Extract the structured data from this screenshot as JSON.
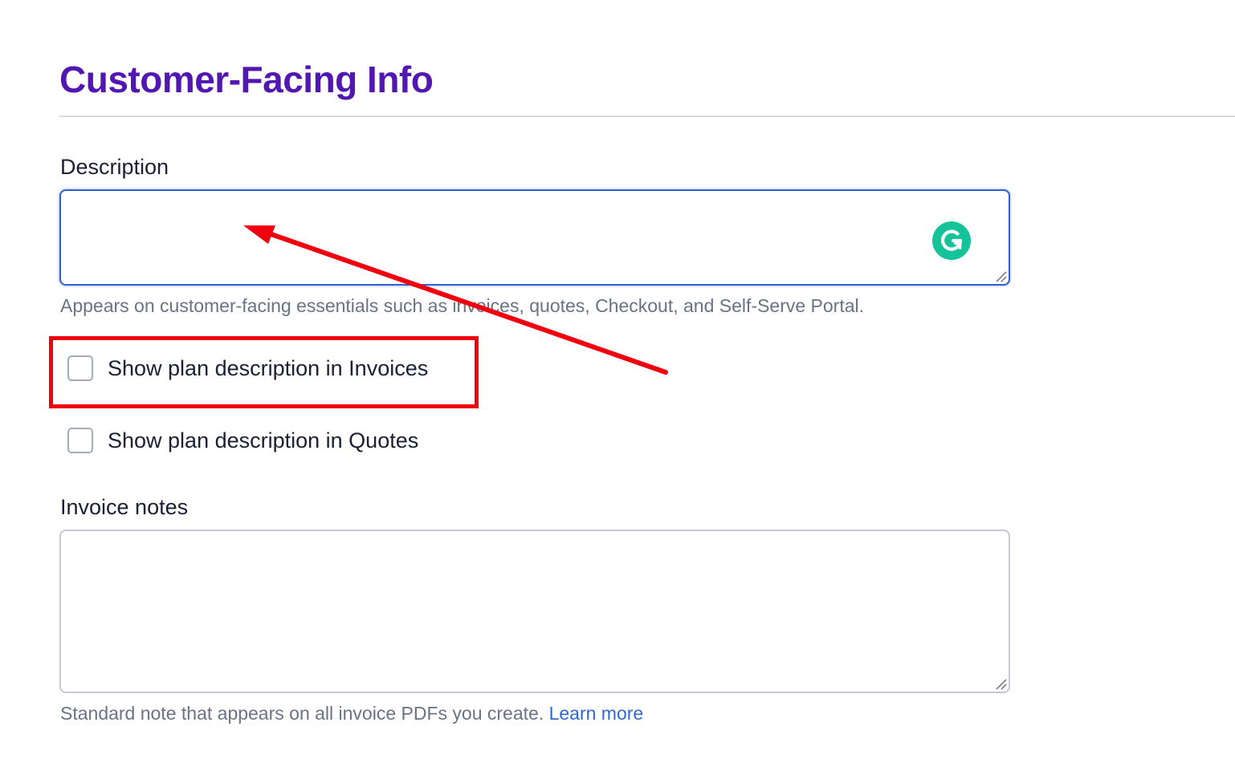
{
  "section": {
    "title": "Customer-Facing Info"
  },
  "description": {
    "label": "Description",
    "value": "",
    "help_text": "Appears on customer-facing essentials such as invoices, quotes, Checkout, and Self-Serve Portal."
  },
  "checkboxes": {
    "invoices": {
      "label": "Show plan description in Invoices",
      "checked": false
    },
    "quotes": {
      "label": "Show plan description in Quotes",
      "checked": false
    }
  },
  "invoice_notes": {
    "label": "Invoice notes",
    "value": "",
    "help_text": "Standard note that appears on all invoice PDFs you create.",
    "link_text": "Learn more"
  },
  "annotation": {
    "highlight_color": "#f0000f",
    "arrow_color": "#f0000f"
  },
  "icons": {
    "grammarly": "grammarly-icon",
    "resize": "resize-handle-icon"
  },
  "colors": {
    "title": "#5117b0",
    "focus_border": "#2f5fd0",
    "link": "#3068d6",
    "grammarly": "#15c39a"
  }
}
